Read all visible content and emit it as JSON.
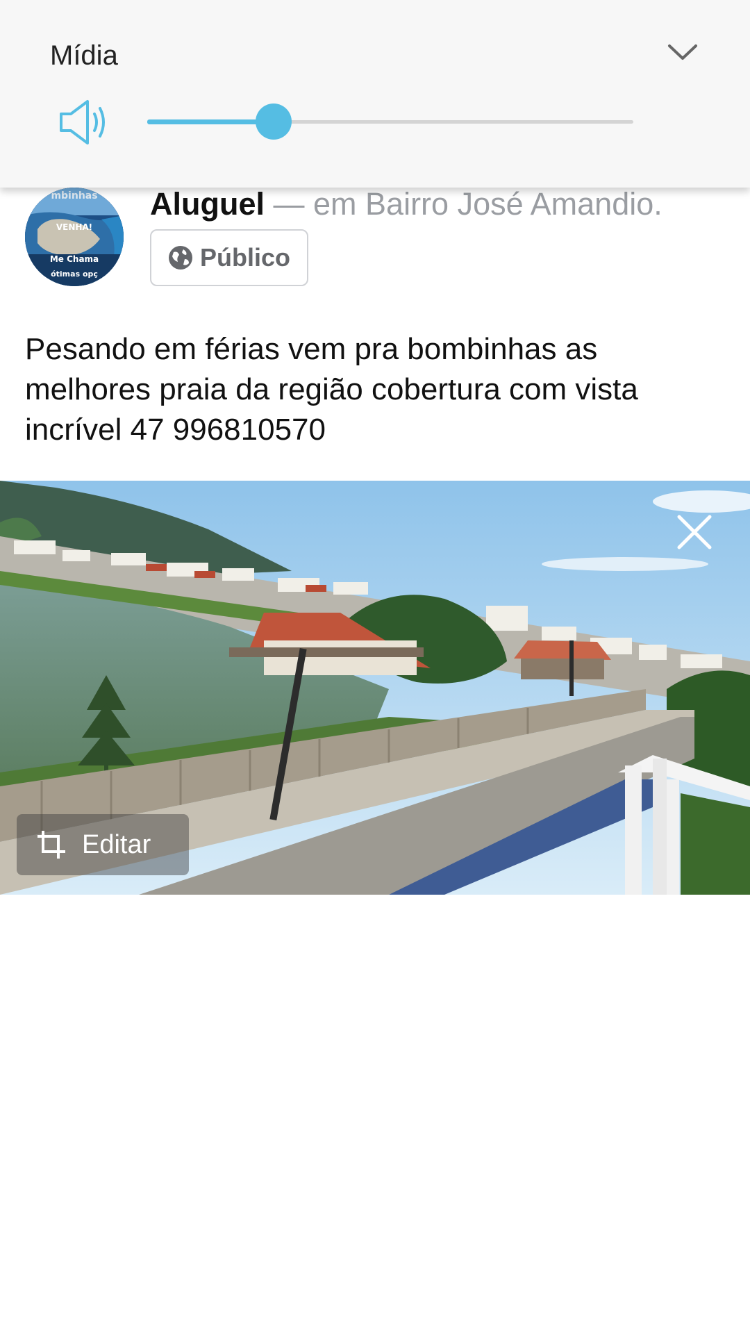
{
  "media_panel": {
    "title": "Mídia",
    "volume_percent": 26,
    "icons": {
      "speaker": "speaker-icon",
      "collapse": "chevron-down-icon"
    },
    "accent_color": "#55bde3"
  },
  "post": {
    "author": "Aluguel",
    "location": "— em Bairro José Amandio.",
    "audience": "Público",
    "text": "Pesando em férias vem pra bombinhas as\nmelhores praia da região cobertura  com vista\nincrível 47 996810570",
    "avatar_text": [
      "mbinhas",
      "VENHA!",
      "Me Chama",
      "ótimas opç"
    ]
  },
  "photo": {
    "edit_label": "Editar",
    "icons": {
      "remove": "close-icon",
      "edit": "crop-icon"
    }
  }
}
